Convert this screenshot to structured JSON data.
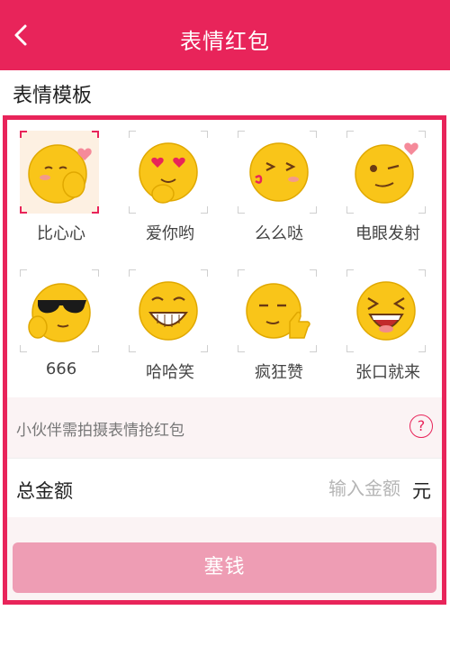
{
  "header": {
    "title": "表情红包"
  },
  "section": {
    "title": "表情模板"
  },
  "stickers": [
    {
      "label": "比心心",
      "icon": "heart-finger-emoji",
      "selected": true
    },
    {
      "label": "爱你哟",
      "icon": "heart-eyes-emoji",
      "selected": false
    },
    {
      "label": "么么哒",
      "icon": "kiss-emoji",
      "selected": false
    },
    {
      "label": "电眼发射",
      "icon": "wink-emoji",
      "selected": false
    },
    {
      "label": "666",
      "icon": "sunglasses-emoji",
      "selected": false
    },
    {
      "label": "哈哈笑",
      "icon": "laughing-emoji",
      "selected": false
    },
    {
      "label": "疯狂赞",
      "icon": "thumbs-up-emoji",
      "selected": false
    },
    {
      "label": "张口就来",
      "icon": "open-mouth-laugh-emoji",
      "selected": false
    }
  ],
  "hint": {
    "text": "小伙伴需拍摄表情抢红包",
    "help_icon": "?"
  },
  "amount": {
    "label": "总金额",
    "placeholder": "输入金额",
    "unit": "元"
  },
  "submit": {
    "label": "塞钱"
  },
  "colors": {
    "brand": "#e8245a",
    "button": "#ee9db4"
  }
}
